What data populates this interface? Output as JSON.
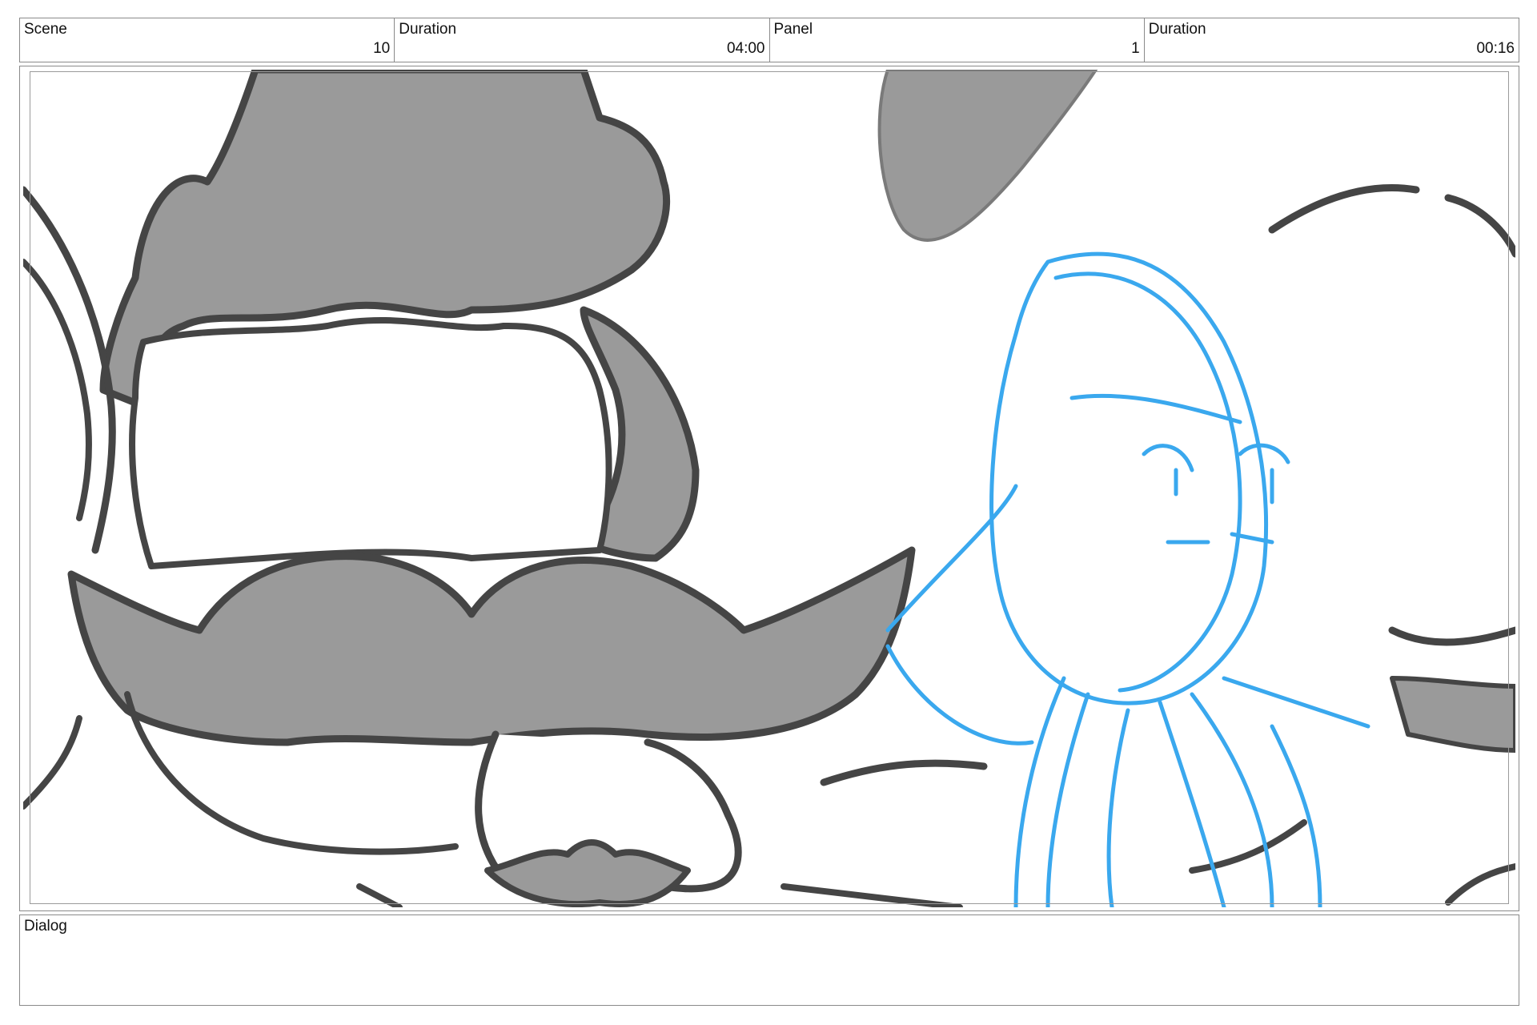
{
  "header": {
    "cells": [
      {
        "label": "Scene",
        "value": "10"
      },
      {
        "label": "Duration",
        "value": "04:00"
      },
      {
        "label": "Panel",
        "value": "1"
      },
      {
        "label": "Duration",
        "value": "00:16"
      }
    ]
  },
  "dialog": {
    "label": "Dialog",
    "text": ""
  },
  "colors": {
    "border": "#8a8a8a",
    "ink_dark": "#454545",
    "fill_gray": "#9a9a9a",
    "sketch_blue": "#3aa8ee"
  }
}
